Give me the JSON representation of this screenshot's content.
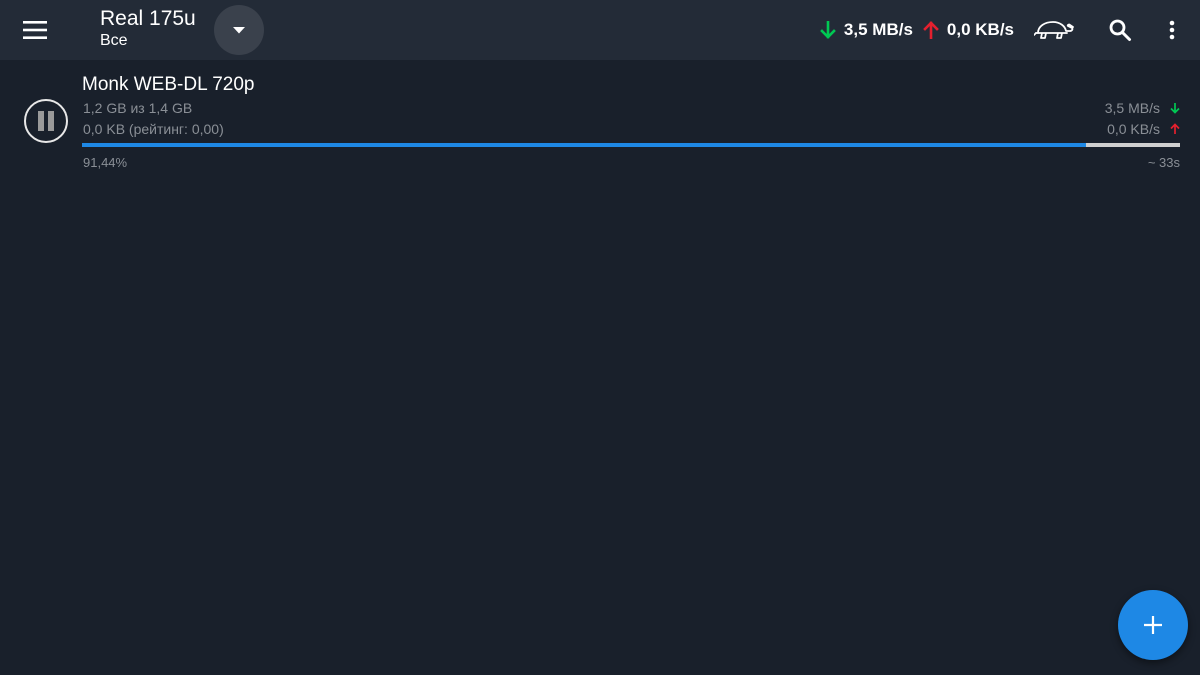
{
  "header": {
    "title": "Real 175u",
    "subtitle": "Все",
    "download_speed": "3,5 MB/s",
    "upload_speed": "0,0 KB/s",
    "icons": {
      "menu": "menu-icon",
      "dropdown": "caret-down-icon",
      "download": "arrow-down-icon",
      "upload": "arrow-up-icon",
      "speed_limit": "turtle-icon",
      "search": "search-icon",
      "more": "more-vert-icon"
    }
  },
  "torrents": [
    {
      "name": "Monk WEB-DL 720p",
      "size_progress": "1,2 GB из 1,4 GB",
      "uploaded": "0,0 KB (рейтинг: 0,00)",
      "download_speed": "3,5 MB/s",
      "upload_speed": "0,0 KB/s",
      "percent_text": "91,44%",
      "progress": 0.9144,
      "eta": "~ 33s",
      "state_icon": "pause-icon"
    }
  ],
  "fab": {
    "icon": "plus-icon"
  },
  "colors": {
    "background": "#19202b",
    "toolbar": "#232b37",
    "accent": "#1e88e5",
    "download_arrow": "#00c853",
    "upload_arrow": "#e5202e",
    "secondary_text": "#8a8f96"
  }
}
